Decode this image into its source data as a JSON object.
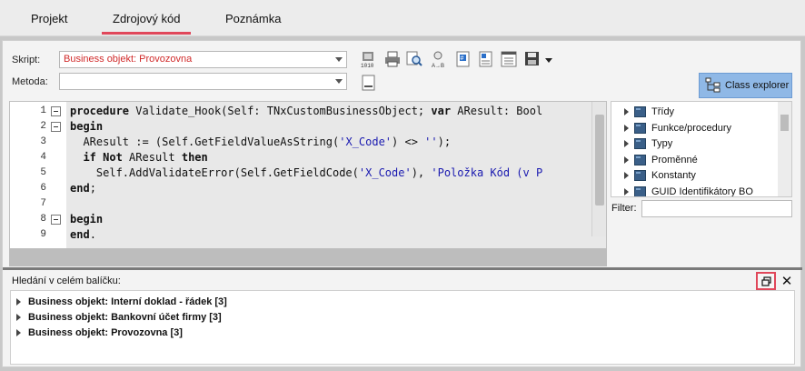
{
  "tabs": [
    {
      "label": "Projekt"
    },
    {
      "label": "Zdrojový kód",
      "active": true
    },
    {
      "label": "Poznámka"
    }
  ],
  "skript": {
    "label": "Skript:",
    "value": "Business objekt: Provozovna"
  },
  "metoda": {
    "label": "Metoda:",
    "value": ""
  },
  "toolbar_icons": [
    "binary-icon",
    "print-icon",
    "search-icon",
    "replace-icon",
    "compile-icon",
    "notes-icon",
    "list-icon",
    "save-icon"
  ],
  "class_explorer": {
    "label": "Class explorer"
  },
  "code": {
    "lines": [
      {
        "n": "1",
        "fold": true,
        "text": "procedure Validate_Hook(Self: TNxCustomBusinessObject; var AResult: Bool"
      },
      {
        "n": "2",
        "fold": true,
        "text": "begin"
      },
      {
        "n": "3",
        "fold": false,
        "text": "  AResult := (Self.GetFieldValueAsString('X_Code') <> '');"
      },
      {
        "n": "4",
        "fold": false,
        "text": "  if Not AResult then"
      },
      {
        "n": "5",
        "fold": false,
        "text": "    Self.AddValidateError(Self.GetFieldCode('X_Code'), 'Položka Kód (v P"
      },
      {
        "n": "6",
        "fold": false,
        "text": "end;"
      },
      {
        "n": "7",
        "fold": false,
        "text": ""
      },
      {
        "n": "8",
        "fold": true,
        "text": "begin"
      },
      {
        "n": "9",
        "fold": false,
        "text": "end."
      }
    ]
  },
  "tree": {
    "items": [
      "Třídy",
      "Funkce/procedury",
      "Typy",
      "Proměnné",
      "Konstanty",
      "GUID Identifikátory BO"
    ]
  },
  "filter": {
    "label": "Filter:",
    "value": ""
  },
  "search": {
    "header": "Hledání v celém balíčku:",
    "results": [
      "Business objekt: Interní doklad - řádek [3]",
      "Business objekt: Bankovní účet firmy [3]",
      "Business objekt: Provozovna [3]"
    ]
  },
  "colors": {
    "accent": "#e0475a",
    "error_text": "#d12b2b",
    "class_explorer_bg": "#8fb8e6"
  }
}
